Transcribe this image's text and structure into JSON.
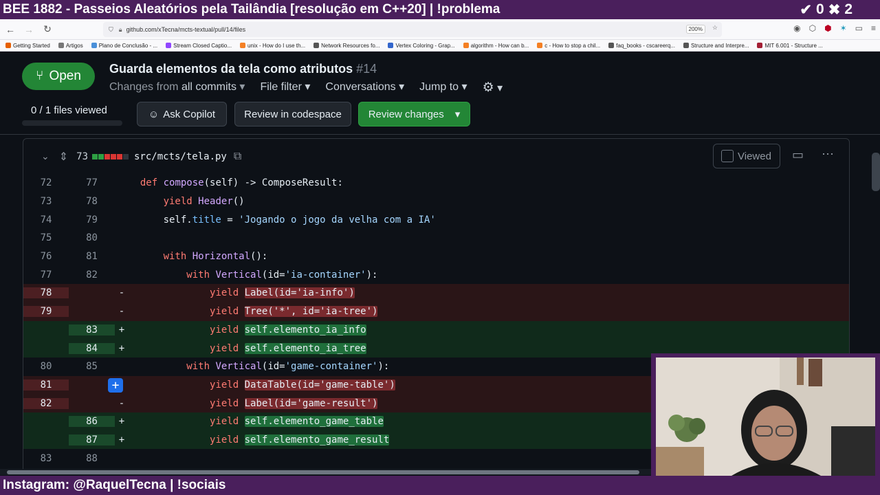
{
  "stream": {
    "title": "BEE 1882 - Passeios Aleatórios pela Tailândia [resolução em C++20] | !problema",
    "check_count": "0",
    "cross_count": "2",
    "footer": "Instagram: @RaquelTecna | !sociais"
  },
  "browser": {
    "url": "github.com/xTecna/mcts-textual/pull/14/files",
    "zoom": "200%",
    "bookmarks": [
      {
        "label": "Getting Started",
        "color": "#e66000"
      },
      {
        "label": "Artigos",
        "color": "#777777"
      },
      {
        "label": "Plano de Conclusão - ...",
        "color": "#4a90d9"
      },
      {
        "label": "Stream Closed Captio...",
        "color": "#9146ff"
      },
      {
        "label": "unix - How do I use th...",
        "color": "#f48024"
      },
      {
        "label": "Network Resources fo...",
        "color": "#555555"
      },
      {
        "label": "Vertex Coloring - Grap...",
        "color": "#3366cc"
      },
      {
        "label": "algorithm - How can b...",
        "color": "#f48024"
      },
      {
        "label": "c - How to stop a chil...",
        "color": "#f48024"
      },
      {
        "label": "faq_books - cscareerq...",
        "color": "#555555"
      },
      {
        "label": "Structure and Interpre...",
        "color": "#555555"
      },
      {
        "label": "MIT 6.001 - Structure ...",
        "color": "#a31f34"
      }
    ]
  },
  "pr": {
    "state": "Open",
    "title": "Guarda elementos da tela como atributos",
    "number": "#14",
    "filters": {
      "changes_prefix": "Changes from",
      "changes_value": "all commits",
      "file_filter": "File filter",
      "conversations": "Conversations",
      "jump_to": "Jump to"
    },
    "files_viewed": "0 / 1 files viewed",
    "buttons": {
      "ask_copilot": "Ask Copilot",
      "codespace": "Review in codespace",
      "review_changes": "Review changes"
    }
  },
  "file": {
    "changes": "73",
    "path": "src/mcts/tela.py",
    "viewed_label": "Viewed"
  },
  "colors": {
    "open_green": "#238636",
    "deleted_bg": "#2a1517",
    "added_bg": "#102a1b",
    "stream_purple": "#4a1f5c"
  }
}
